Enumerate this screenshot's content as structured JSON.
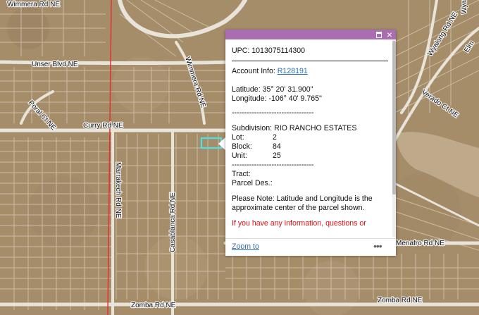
{
  "map": {
    "road_labels": [
      {
        "id": "wimmera-top",
        "text": "Wimmera Rd NE"
      },
      {
        "id": "unser",
        "text": "Unser Blvd NE"
      },
      {
        "id": "wimmera-right",
        "text": "Wimmera Rd NE"
      },
      {
        "id": "poral",
        "text": "Poral Ct NE"
      },
      {
        "id": "curry",
        "text": "Curry Rd NE"
      },
      {
        "id": "marrakech",
        "text": "Marrakech Rd NE"
      },
      {
        "id": "casablanca",
        "text": "Casablanca Rd NE"
      },
      {
        "id": "zomba",
        "text": "Zomba Rd NE"
      },
      {
        "id": "zomba-right",
        "text": "Zomba Rd NE"
      },
      {
        "id": "wyatt",
        "text": "Wyatt"
      },
      {
        "id": "wyalong",
        "text": "Wyalong Rd NE"
      },
      {
        "id": "elm",
        "text": "Elm"
      },
      {
        "id": "verado",
        "text": "Verado Ct NE"
      },
      {
        "id": "menafro",
        "text": "Menafro Rd NE"
      }
    ]
  },
  "popup": {
    "upc_label": "UPC: ",
    "upc": "1013075114300",
    "account_label": "Account Info: ",
    "account_link": "R128191",
    "latitude": "Latitude: 35° 20' 31.900\"",
    "longitude": "Longitude: -106° 40' 9.765\"",
    "separator": "---------------------------------",
    "subdivision": "Subdivision: RIO RANCHO ESTATES",
    "lot_label": "Lot:",
    "lot": "2",
    "block_label": "Block:",
    "block": "84",
    "unit_label": "Unit:",
    "unit": "25",
    "separator2": "---------------------------------",
    "tract": "Tract:",
    "parcel_des": "Parcel Des.:",
    "note_line1": "Please Note: Latitude and Longitude is the",
    "note_line2": "approximate center of the parcel shown.",
    "red_line": "If you have any information, questions or",
    "zoom_to": "Zoom to",
    "more": "•••",
    "close_icon": "×",
    "colors": {
      "header": "#a86eb0",
      "link": "#2a6ebb",
      "highlight": "#4de1e1"
    }
  }
}
